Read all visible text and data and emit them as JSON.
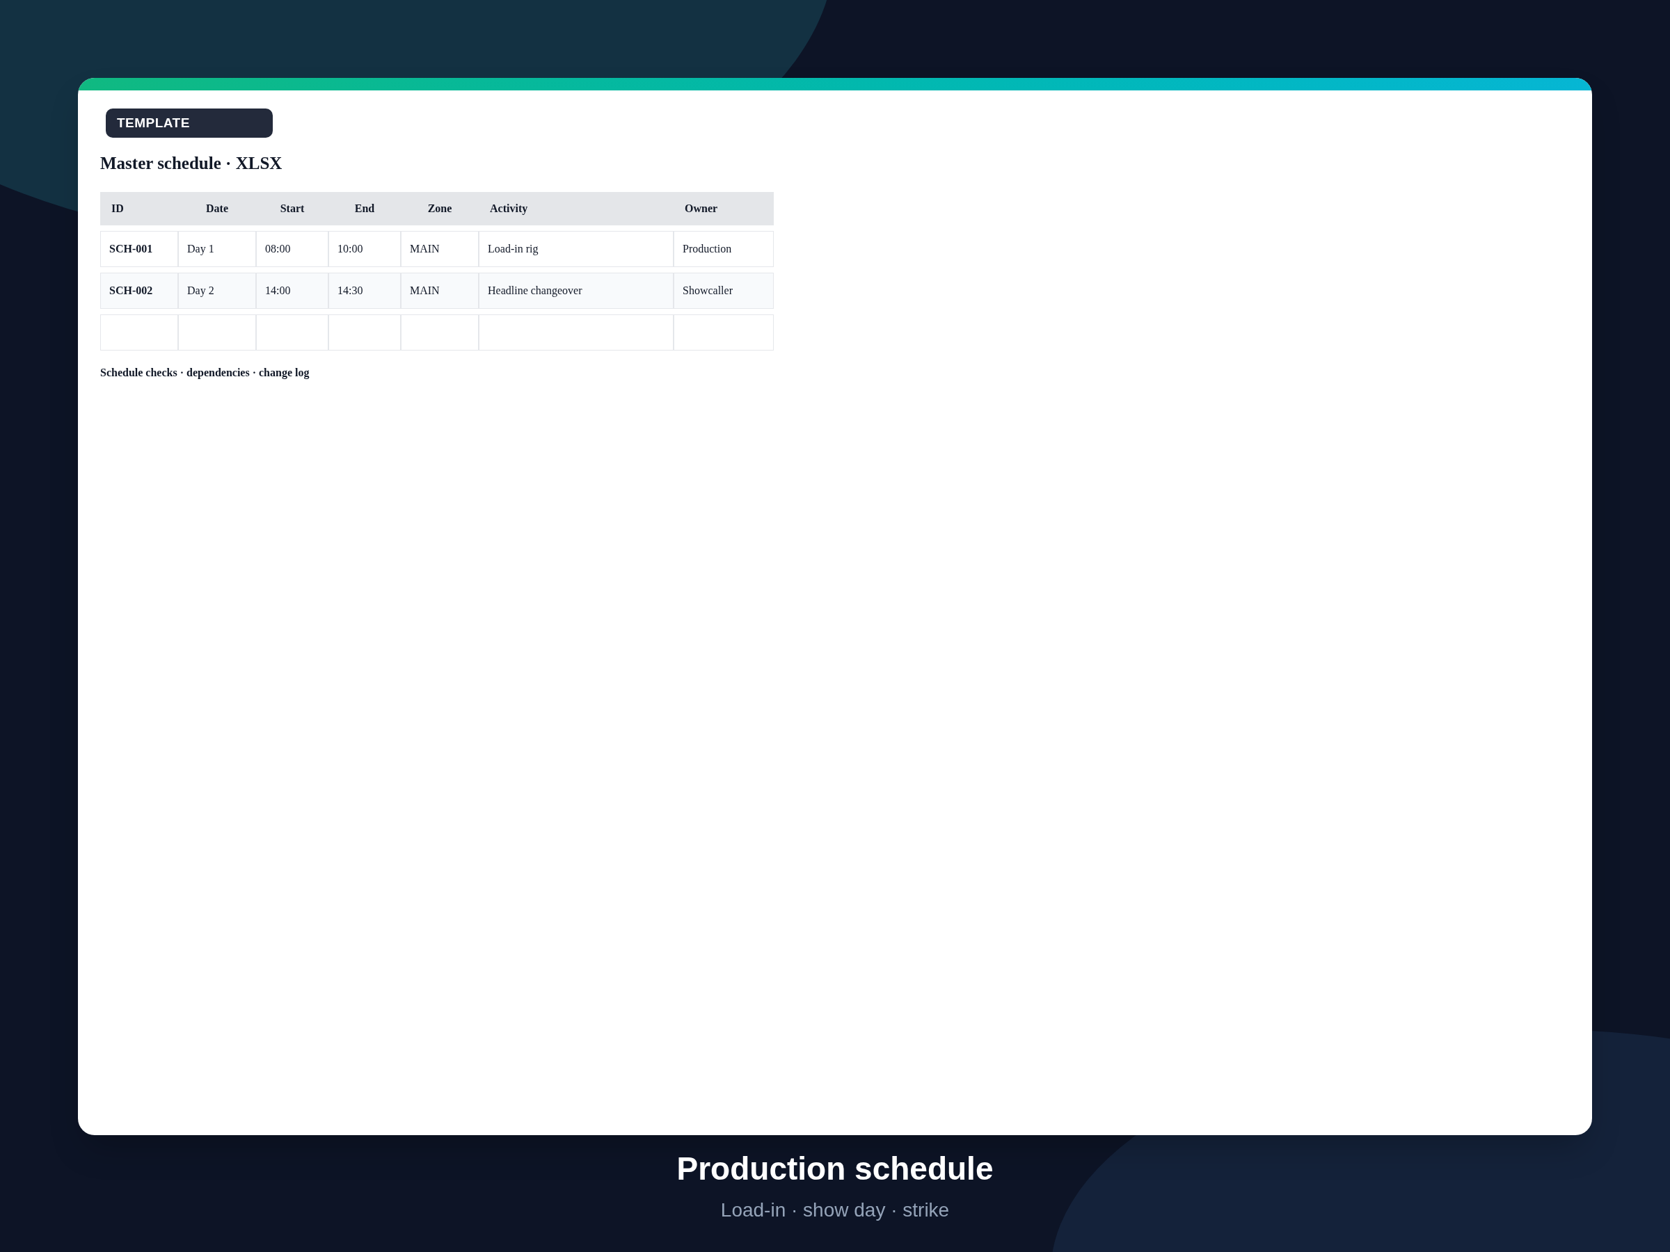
{
  "badge": "TEMPLATE",
  "sheet": {
    "title": "Master schedule · XLSX",
    "columns": [
      "ID",
      "Date",
      "Start",
      "End",
      "Zone",
      "Activity",
      "Owner"
    ],
    "rows": [
      [
        "SCH-001",
        "Day 1",
        "08:00",
        "10:00",
        "MAIN",
        "Load-in rig",
        "Production"
      ],
      [
        "SCH-002",
        "Day 2",
        "14:00",
        "14:30",
        "MAIN",
        "Headline changeover",
        "Showcaller"
      ]
    ],
    "note": "Schedule checks · dependencies · change log"
  },
  "caption": {
    "title": "Production schedule",
    "subtitle": "Load-in · show day · strike"
  }
}
